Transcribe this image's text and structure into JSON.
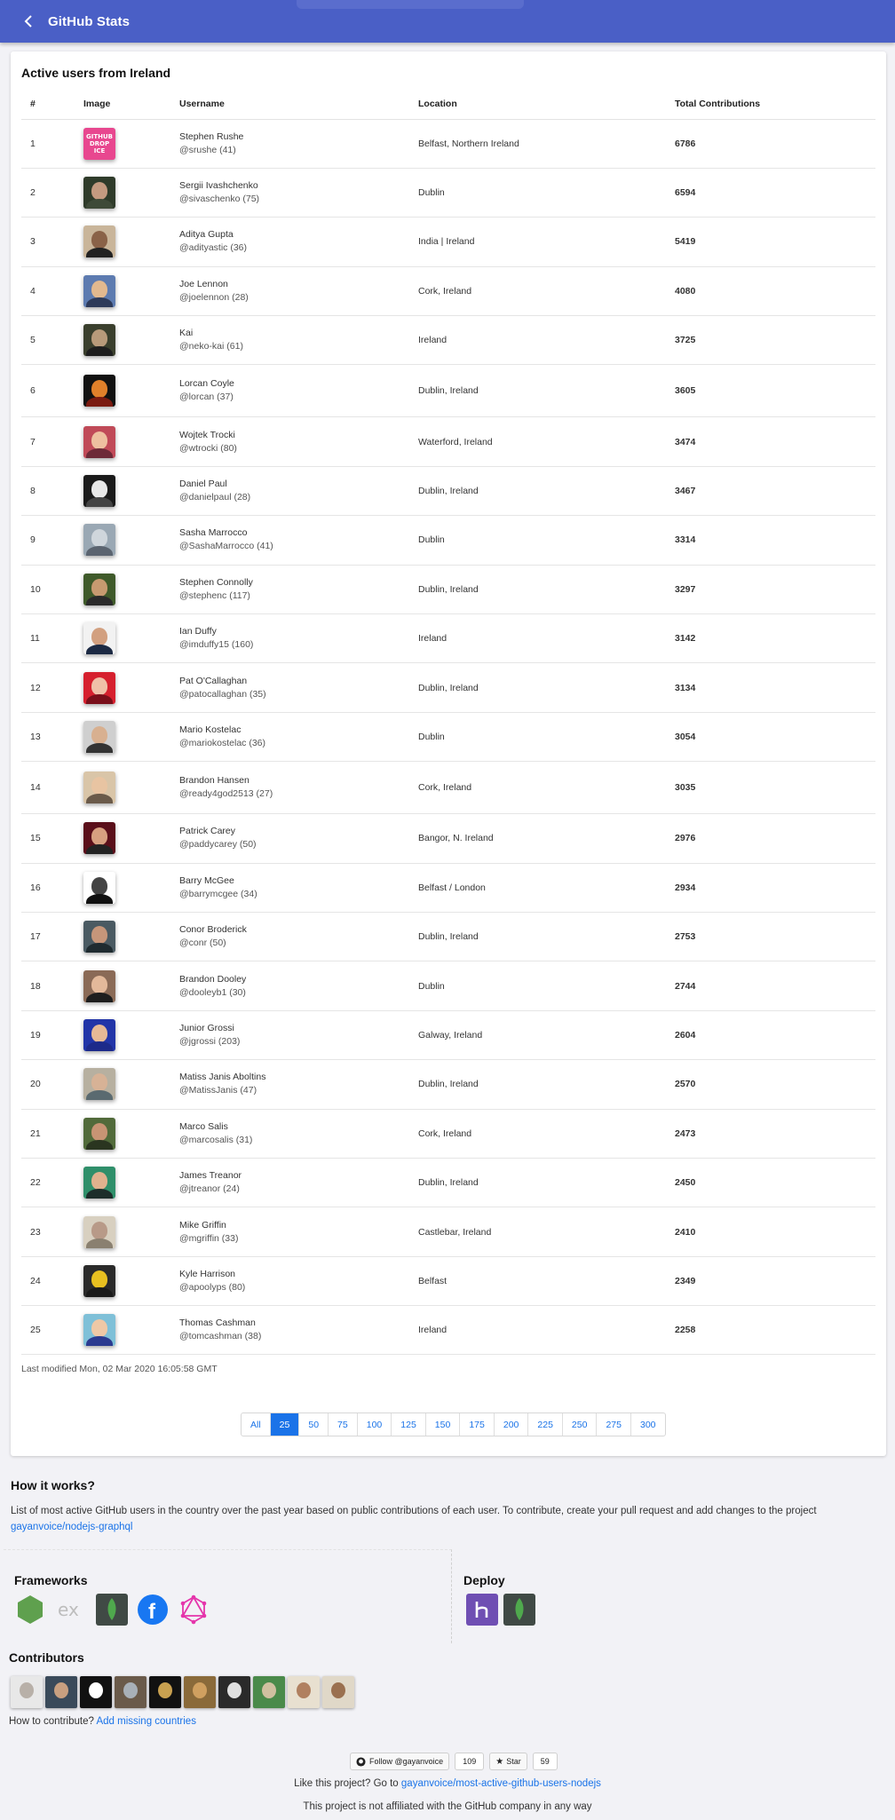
{
  "appbar": {
    "title": "GitHub Stats"
  },
  "card": {
    "title": "Active users from Ireland",
    "headers": {
      "num": "#",
      "image": "Image",
      "username": "Username",
      "location": "Location",
      "total": "Total Contributions"
    },
    "rows": [
      {
        "num": "1",
        "name": "Stephen Rushe",
        "login": "@srushe (41)",
        "location": "Belfast, Northern Ireland",
        "total": "6786",
        "avatar": "github-drop-ice-logo"
      },
      {
        "num": "2",
        "name": "Sergii Ivashchenko",
        "login": "@sivaschenko (75)",
        "location": "Dublin",
        "total": "6594",
        "avatar": "photo"
      },
      {
        "num": "3",
        "name": "Aditya Gupta",
        "login": "@adityastic (36)",
        "location": "India | Ireland",
        "total": "5419",
        "avatar": "photo"
      },
      {
        "num": "4",
        "name": "Joe Lennon",
        "login": "@joelennon (28)",
        "location": "Cork, Ireland",
        "total": "4080",
        "avatar": "photo"
      },
      {
        "num": "5",
        "name": "Kai",
        "login": "@neko-kai (61)",
        "location": "Ireland",
        "total": "3725",
        "avatar": "photo"
      },
      {
        "num": "6",
        "name": "Lorcan Coyle",
        "login": "@lorcan (37)",
        "location": "Dublin, Ireland",
        "total": "3605",
        "avatar": "photo"
      },
      {
        "num": "7",
        "name": "Wojtek Trocki",
        "login": "@wtrocki (80)",
        "location": "Waterford, Ireland",
        "total": "3474",
        "avatar": "photo"
      },
      {
        "num": "8",
        "name": "Daniel Paul",
        "login": "@danielpaul (28)",
        "location": "Dublin, Ireland",
        "total": "3467",
        "avatar": "photo"
      },
      {
        "num": "9",
        "name": "Sasha Marrocco",
        "login": "@SashaMarrocco (41)",
        "location": "Dublin",
        "total": "3314",
        "avatar": "photo"
      },
      {
        "num": "10",
        "name": "Stephen Connolly",
        "login": "@stephenc (117)",
        "location": "Dublin, Ireland",
        "total": "3297",
        "avatar": "photo"
      },
      {
        "num": "11",
        "name": "Ian Duffy",
        "login": "@imduffy15 (160)",
        "location": "Ireland",
        "total": "3142",
        "avatar": "photo"
      },
      {
        "num": "12",
        "name": "Pat O'Callaghan",
        "login": "@patocallaghan (35)",
        "location": "Dublin, Ireland",
        "total": "3134",
        "avatar": "photo"
      },
      {
        "num": "13",
        "name": "Mario Kostelac",
        "login": "@mariokostelac (36)",
        "location": "Dublin",
        "total": "3054",
        "avatar": "photo"
      },
      {
        "num": "14",
        "name": "Brandon Hansen",
        "login": "@ready4god2513 (27)",
        "location": "Cork, Ireland",
        "total": "3035",
        "avatar": "photo"
      },
      {
        "num": "15",
        "name": "Patrick Carey",
        "login": "@paddycarey (50)",
        "location": "Bangor, N. Ireland",
        "total": "2976",
        "avatar": "photo"
      },
      {
        "num": "16",
        "name": "Barry McGee",
        "login": "@barrymcgee (34)",
        "location": "Belfast / London",
        "total": "2934",
        "avatar": "photo"
      },
      {
        "num": "17",
        "name": "Conor Broderick",
        "login": "@conr (50)",
        "location": "Dublin, Ireland",
        "total": "2753",
        "avatar": "photo"
      },
      {
        "num": "18",
        "name": "Brandon Dooley",
        "login": "@dooleyb1 (30)",
        "location": "Dublin",
        "total": "2744",
        "avatar": "photo"
      },
      {
        "num": "19",
        "name": "Junior Grossi",
        "login": "@jgrossi (203)",
        "location": "Galway, Ireland",
        "total": "2604",
        "avatar": "photo"
      },
      {
        "num": "20",
        "name": "Matiss Janis Aboltins",
        "login": "@MatissJanis (47)",
        "location": "Dublin, Ireland",
        "total": "2570",
        "avatar": "photo"
      },
      {
        "num": "21",
        "name": "Marco Salis",
        "login": "@marcosalis (31)",
        "location": "Cork, Ireland",
        "total": "2473",
        "avatar": "photo"
      },
      {
        "num": "22",
        "name": "James Treanor",
        "login": "@jtreanor (24)",
        "location": "Dublin, Ireland",
        "total": "2450",
        "avatar": "photo"
      },
      {
        "num": "23",
        "name": "Mike Griffin",
        "login": "@mgriffin (33)",
        "location": "Castlebar, Ireland",
        "total": "2410",
        "avatar": "photo"
      },
      {
        "num": "24",
        "name": "Kyle Harrison",
        "login": "@apoolyps (80)",
        "location": "Belfast",
        "total": "2349",
        "avatar": "photo"
      },
      {
        "num": "25",
        "name": "Thomas Cashman",
        "login": "@tomcashman (38)",
        "location": "Ireland",
        "total": "2258",
        "avatar": "photo"
      }
    ],
    "last_modified": "Last modified Mon, 02 Mar 2020 16:05:58 GMT",
    "pagination": {
      "options": [
        "All",
        "25",
        "50",
        "75",
        "100",
        "125",
        "150",
        "175",
        "200",
        "225",
        "250",
        "275",
        "300"
      ],
      "selected": "25"
    }
  },
  "how": {
    "title": "How it works?",
    "text": "List of most active GitHub users in the country over the past year based on public contributions of each user. To contribute, create your pull request and add changes to the project",
    "link": "gayanvoice/nodejs-graphql"
  },
  "frameworks": {
    "title": "Frameworks",
    "icons": [
      "nodejs-icon",
      "express-icon",
      "mongodb-icon",
      "facebook-icon",
      "graphql-icon"
    ]
  },
  "deploy": {
    "title": "Deploy",
    "icons": [
      "heroku-icon",
      "mongodb-icon"
    ]
  },
  "contributors": {
    "title": "Contributors",
    "count": 10,
    "how_text": "How to contribute?",
    "how_link": "Add missing countries"
  },
  "footer": {
    "follow_label": "Follow @gayanvoice",
    "follow_count": "109",
    "star_label": "Star",
    "star_count": "59",
    "like_text": "Like this project? Go to",
    "like_link": "gayanvoice/most-active-github-users-nodejs",
    "not_affiliated": "This project is not affiliated with the GitHub company in any way"
  },
  "colors": {
    "appbar": "#4a5fc6",
    "accent": "#1a73e8",
    "logo_pink": "#e8478f"
  }
}
